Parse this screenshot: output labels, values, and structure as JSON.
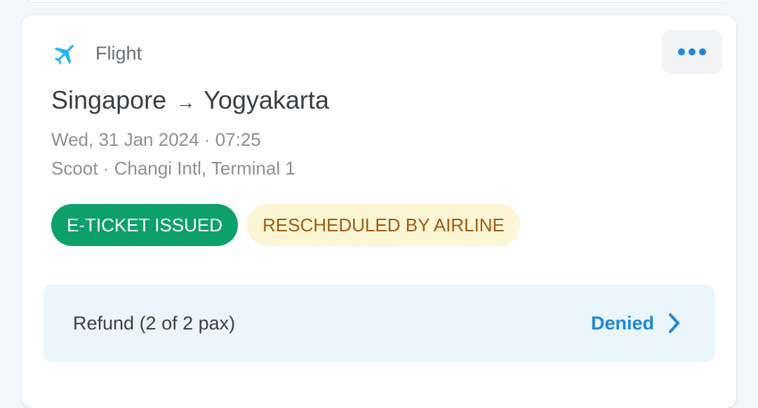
{
  "card": {
    "category": "Flight",
    "category_icon": "airplane-icon",
    "more_icon": "more-horizontal-icon",
    "route": {
      "origin": "Singapore",
      "arrow": "→",
      "destination": "Yogyakarta"
    },
    "datetime": "Wed, 31 Jan 2024 · 07:25",
    "carrier": "Scoot · Changi Intl, Terminal 1",
    "badges": [
      {
        "label": "E-TICKET ISSUED",
        "color": "#0ea06a"
      },
      {
        "label": "RESCHEDULED BY AIRLINE",
        "color": "#fdf6d5"
      }
    ],
    "refund": {
      "label": "Refund (2 of 2 pax)",
      "status": "Denied",
      "status_color": "#1b87d9",
      "chevron_icon": "chevron-right-icon"
    }
  },
  "colors": {
    "accent": "#1b87d9",
    "plane_icon": "#2ab4ea",
    "success": "#0ea06a",
    "warning_bg": "#fdf6d5",
    "warning_text": "#a05a11",
    "refund_bg": "#eaf6fc"
  }
}
